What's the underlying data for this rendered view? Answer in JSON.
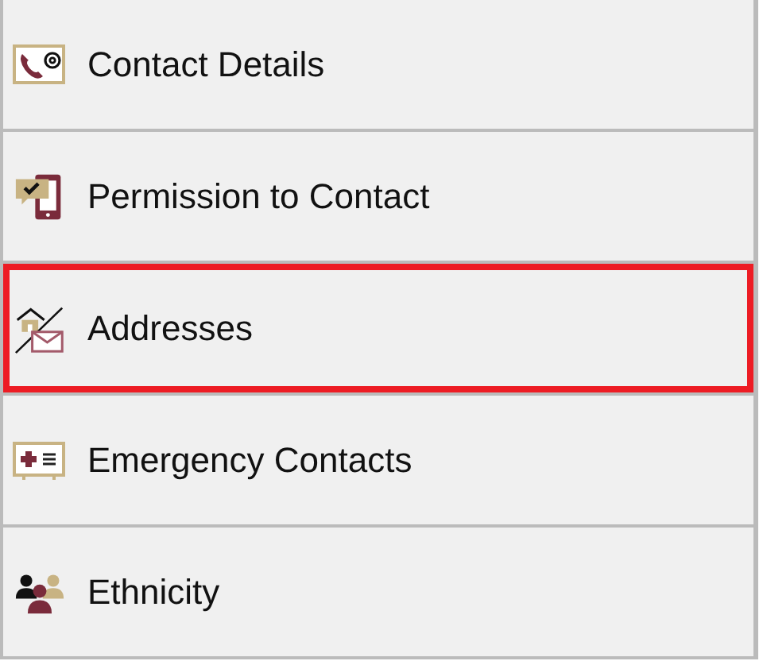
{
  "items": [
    {
      "label": "Contact Details",
      "kind": "contact",
      "selected": false
    },
    {
      "label": "Permission to Contact",
      "kind": "permission",
      "selected": false
    },
    {
      "label": "Addresses",
      "kind": "address",
      "selected": true
    },
    {
      "label": "Emergency Contacts",
      "kind": "emergency",
      "selected": false
    },
    {
      "label": "Ethnicity",
      "kind": "ethnicity",
      "selected": false
    }
  ]
}
